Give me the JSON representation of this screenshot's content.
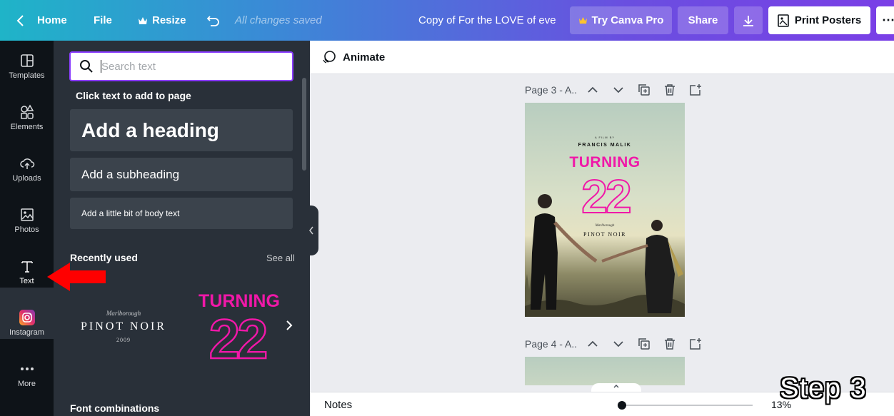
{
  "topbar": {
    "home": "Home",
    "file": "File",
    "resize": "Resize",
    "saved": "All changes saved",
    "doc_title": "Copy of For the LOVE of eve",
    "try_pro": "Try Canva Pro",
    "share": "Share",
    "print": "Print Posters",
    "more": "⋯"
  },
  "rail": {
    "items": [
      {
        "label": "Templates",
        "icon": "templates-icon"
      },
      {
        "label": "Elements",
        "icon": "elements-icon"
      },
      {
        "label": "Uploads",
        "icon": "cloud-upload-icon"
      },
      {
        "label": "Photos",
        "icon": "photo-icon"
      },
      {
        "label": "Text",
        "icon": "text-t-icon"
      },
      {
        "label": "Instagram",
        "icon": "instagram-icon"
      },
      {
        "label": "More",
        "icon": "more-dots-icon"
      }
    ],
    "active": "Text"
  },
  "panel": {
    "search_placeholder": "Search text",
    "click_label": "Click text to add to page",
    "heading": "Add a heading",
    "subheading": "Add a subheading",
    "body": "Add a little bit of body text",
    "recent_title": "Recently used",
    "see_all": "See all",
    "combo1": {
      "small": "Marlborough",
      "main": "PINOT NOIR",
      "year": "2009"
    },
    "combo2": {
      "title": "TURNING",
      "number": "22"
    },
    "font_combinations": "Font combinations"
  },
  "canvas": {
    "animate": "Animate",
    "page3": "Page 3 - A..",
    "page4": "Page 4 - A..",
    "poster": {
      "film": "A FILM BY",
      "director": "FRANCIS MALIK",
      "title": "TURNING",
      "number": "22",
      "small": "Marlborough",
      "wine": "PINOT NOIR"
    }
  },
  "bottom": {
    "notes": "Notes",
    "zoom": "13%"
  },
  "overlay": {
    "step": "Step 3"
  },
  "colors": {
    "accent": "#8b3dff",
    "highlight": "#f018a8",
    "arrow": "#ff0000"
  }
}
